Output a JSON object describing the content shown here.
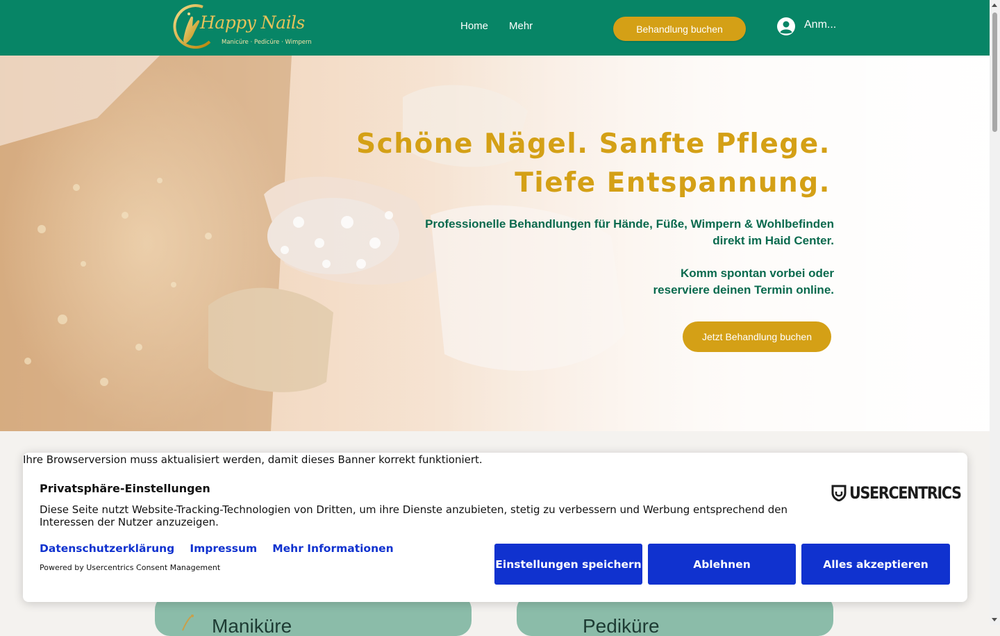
{
  "header": {
    "logo_text": "Happy Nails",
    "logo_subtitle": "Manicüre · Pedicüre · Wimpern",
    "nav": {
      "home": "Home",
      "more": "Mehr"
    },
    "book_button": "Behandlung buchen",
    "login_label": "Anm..."
  },
  "hero": {
    "title_line1": "Schöne Nägel. Sanfte Pflege.",
    "title_line2": "Tiefe Entspannung.",
    "text_line1": "Professionelle Behandlungen für Hände, Füße, Wimpern & Wohlbefinden",
    "text_line2": "direkt im Haid Center.",
    "text_line3": "Komm spontan vorbei oder",
    "text_line4": "reserviere deinen Termin online.",
    "cta": "Jetzt Behandlung buchen"
  },
  "cards": {
    "left_title": "Maniküre",
    "right_title": "Pediküre"
  },
  "consent": {
    "browser_warning": "Ihre Browserversion muss aktualisiert werden, damit dieses Banner korrekt funktioniert.",
    "title": "Privatsphäre-Einstellungen",
    "description": "Diese Seite nutzt Website-Tracking-Technologien von Dritten, um ihre Dienste anzubieten, stetig zu verbessern und Werbung entsprechend den Interessen der Nutzer anzuzeigen.",
    "links": {
      "privacy": "Datenschutzerklärung",
      "imprint": "Impressum",
      "more_info": "Mehr Informationen"
    },
    "powered_by": "Powered by Usercentrics Consent Management",
    "brand": "USERCENTRICS",
    "buttons": {
      "settings": "Einstellungen speichern",
      "deny": "Ablehnen",
      "accept": "Alles akzeptieren"
    }
  },
  "colors": {
    "header_green": "#078566",
    "gold": "#d4a016",
    "consent_blue": "#1032cf",
    "hero_text_green": "#0a6a4e"
  }
}
